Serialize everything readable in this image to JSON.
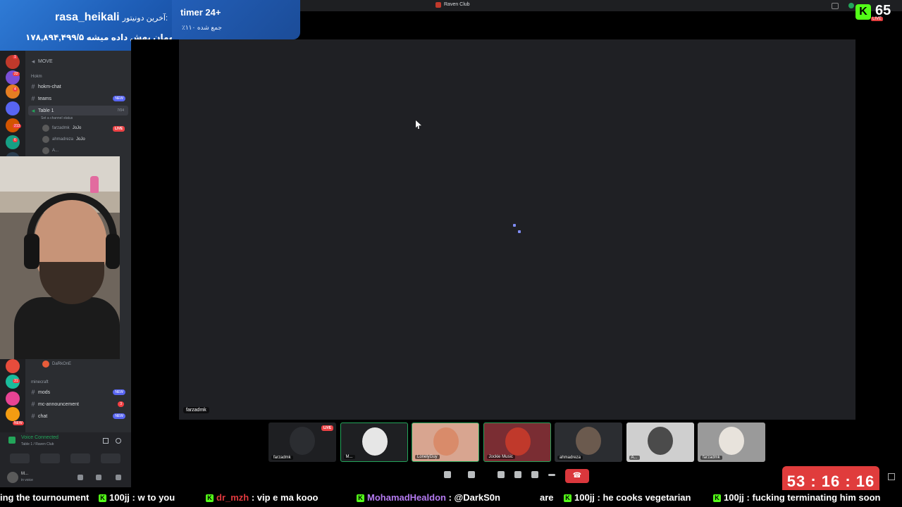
{
  "window": {
    "title": "Raven Club"
  },
  "donation": {
    "label": "آخرین دونیتور:",
    "name": "rasa_heikali",
    "amount_line": "۱۷۸,۸۹۴,۴۹۹/۵ تومان بهش داده میشه"
  },
  "timer_box": {
    "title": "timer 24+",
    "subtitle": "٪۱۱۰ جمع شده"
  },
  "top_right": {
    "k_glyph": "K",
    "count": "65",
    "live": "LIVE"
  },
  "servers": {
    "badges": [
      "1",
      "22",
      "4",
      "213",
      "6",
      "31",
      "NEW"
    ],
    "colors": [
      "#c0392b",
      "#7a4fd6",
      "#e67e22",
      "#5865f2",
      "#d35400",
      "#16a085",
      "#2c3e50",
      "#e74c3c",
      "#1abc9c",
      "#e84393",
      "#f39c12"
    ]
  },
  "channels": {
    "move_label": "MOVE",
    "category_hokm": "Hokm",
    "items": [
      {
        "name": "hokm-chat",
        "badge": ""
      },
      {
        "name": "teams",
        "badge": "NEW"
      },
      {
        "name": "Table 1",
        "badge": ""
      }
    ],
    "table_status": "Set a channel status",
    "table_count": "7/04",
    "voice_users": [
      {
        "name": "farzadmk",
        "tag": "JoJo",
        "live": "LIVE"
      },
      {
        "name": "ahmadreza",
        "tag": "JoJo",
        "live": ""
      },
      {
        "name": "A...",
        "tag": "",
        "live": ""
      }
    ],
    "darkone": "DaRkOnE",
    "category_minecraft": "minecraft",
    "mc_items": [
      {
        "name": "mods",
        "badge": "NEW",
        "badge_type": "new"
      },
      {
        "name": "mc-announcement",
        "badge": "3",
        "badge_type": "red"
      },
      {
        "name": "chat",
        "badge": "NEW",
        "badge_type": "new"
      }
    ]
  },
  "voice_panel": {
    "status": "Voice Connected",
    "sub": "Table 1 / Raven Club"
  },
  "user_panel": {
    "name": "M...",
    "status": "in voice"
  },
  "stream": {
    "label": "farzadmk"
  },
  "tiles": [
    {
      "label": "farzadmk",
      "face": "#2b2d31",
      "bg": "#1e1f22",
      "live": "LIVE",
      "speaking": false
    },
    {
      "label": "M...",
      "face": "#e6e6e6",
      "bg": "#1e1f22",
      "live": "",
      "speaking": true
    },
    {
      "label": "LonelyGuy",
      "face": "#d98b6a",
      "bg": "#d8a590",
      "live": "",
      "speaking": true
    },
    {
      "label": "Jockie Music",
      "face": "#c0392b",
      "bg": "#7a2d33",
      "live": "",
      "speaking": true
    },
    {
      "label": "ahmadreza",
      "face": "#6b5a4e",
      "bg": "#2b2d31",
      "live": "",
      "speaking": false
    },
    {
      "label": "A...",
      "face": "#4b4b4b",
      "bg": "#cfcfcf",
      "live": "",
      "speaking": false
    },
    {
      "label": "farzadmk",
      "face": "#e8e3dc",
      "bg": "#9a9a9a",
      "live": "",
      "speaking": false
    }
  ],
  "hangup_icon": "phone-hangup-icon",
  "countdown": "53 : 16 : 16",
  "ticker": [
    {
      "user": "",
      "text": "ing the tournoument",
      "user_color": ""
    },
    {
      "user": "100jj",
      "text": " : w to you",
      "user_color": "#ffffff"
    },
    {
      "user": "dr_mzh",
      "text": " : vip e ma kooo",
      "user_color": "#e0393e"
    },
    {
      "user": "MohamadHealdon",
      "text": " : @DarkS0n",
      "user_color": "#b47af0"
    },
    {
      "user": "",
      "text": "are",
      "user_color": ""
    },
    {
      "user": "100jj",
      "text": " : he cooks vegetarian",
      "user_color": "#ffffff"
    },
    {
      "user": "100jj",
      "text": " : fucking terminating him soon",
      "user_color": "#ffffff"
    }
  ]
}
